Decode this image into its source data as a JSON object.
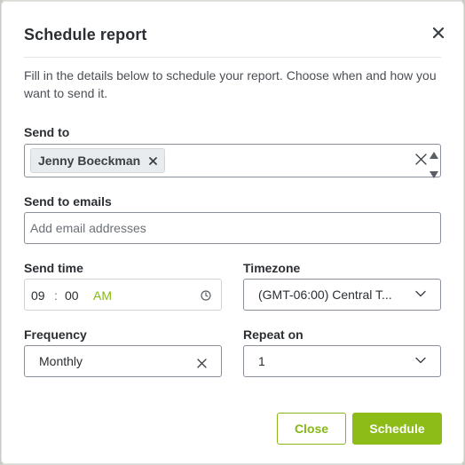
{
  "dialog": {
    "title": "Schedule report",
    "description": "Fill in the details below to schedule your report. Choose when and how you want to send it."
  },
  "send_to": {
    "label": "Send to",
    "chips": [
      "Jenny Boeckman"
    ]
  },
  "send_to_emails": {
    "label": "Send to emails",
    "placeholder": "Add email addresses"
  },
  "send_time": {
    "label": "Send time",
    "hour": "09",
    "separator": ":",
    "minute": "00",
    "ampm": "AM"
  },
  "timezone": {
    "label": "Timezone",
    "value": "(GMT-06:00) Central T..."
  },
  "frequency": {
    "label": "Frequency",
    "value": "Monthly"
  },
  "repeat_on": {
    "label": "Repeat on",
    "value": "1"
  },
  "buttons": {
    "close": "Close",
    "schedule": "Schedule"
  },
  "colors": {
    "accent": "#86b817",
    "primary_button": "#8dbb18"
  },
  "icons": {
    "close": "close-icon",
    "chip_remove": "chip-remove-icon",
    "clear": "clear-icon",
    "clock": "clock-icon",
    "chevron": "chevron-down-icon"
  }
}
